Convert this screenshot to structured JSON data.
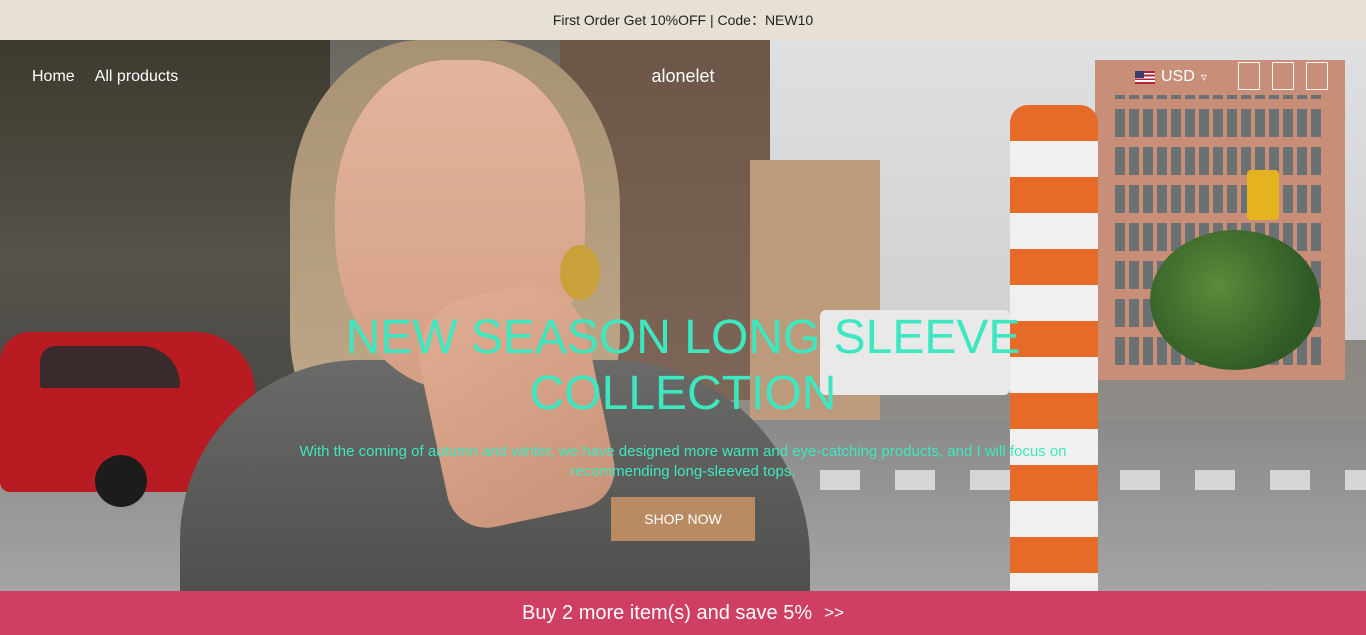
{
  "announcement": "First Order Get 10%OFF | Code：NEW10",
  "header": {
    "nav": [
      {
        "label": "Home"
      },
      {
        "label": "All products"
      }
    ],
    "logo": "alonelet",
    "currency": "USD",
    "currency_caret": "▿"
  },
  "hero": {
    "title": "NEW SEASON LONG SLEEVE COLLECTION",
    "subtitle": "With the coming of autumn and winter, we have designed more warm and eye-catching products, and I will focus on recommending long-sleeved tops.",
    "cta": "SHOP NOW",
    "text_color": "#3de8c0"
  },
  "promo_bar": {
    "text": "Buy 2 more item(s) and save 5%",
    "arrow": ">>",
    "color": "#cf3e63"
  }
}
